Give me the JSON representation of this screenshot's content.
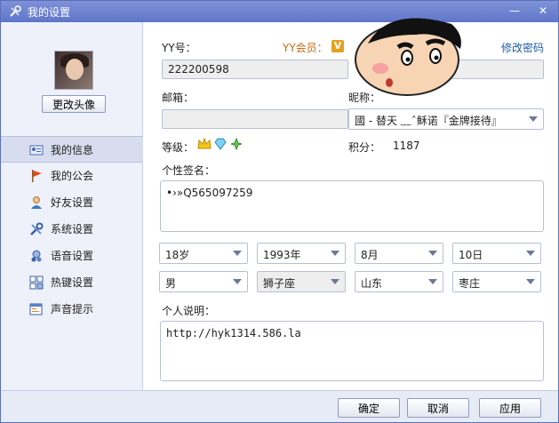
{
  "window": {
    "title": "我的设置",
    "minimize": "—",
    "close": "✕"
  },
  "sidebar": {
    "change_avatar": "更改头像",
    "items": [
      {
        "label": "我的信息",
        "icon": "id-card-icon"
      },
      {
        "label": "我的公会",
        "icon": "flag-icon"
      },
      {
        "label": "好友设置",
        "icon": "friend-icon"
      },
      {
        "label": "系统设置",
        "icon": "tools-icon"
      },
      {
        "label": "语音设置",
        "icon": "voice-icon"
      },
      {
        "label": "热键设置",
        "icon": "keyboard-icon"
      },
      {
        "label": "声音提示",
        "icon": "sound-icon"
      }
    ]
  },
  "form": {
    "yy_label": "YY号：",
    "yy_value": "222200598",
    "vip_label": "YY会员：",
    "vip_badge": "V",
    "change_password": "修改密码",
    "email_label": "邮箱：",
    "email_value": "",
    "nick_label": "昵称：",
    "nick_value": "國 - 替天 ﹏ˆ稣诺『金牌接待』",
    "level_label": "等级：",
    "points_label": "积分：",
    "points_value": "1187",
    "signature_label": "个性签名：",
    "signature_value": "•›»Q565097259",
    "age": "18岁",
    "year": "1993年",
    "month": "8月",
    "day": "10日",
    "gender": "男",
    "zodiac": "狮子座",
    "province": "山东",
    "city": "枣庄",
    "desc_label": "个人说明：",
    "desc_value": "http://hyk1314.586.la"
  },
  "buttons": {
    "ok": "确定",
    "cancel": "取消",
    "apply": "应用"
  }
}
